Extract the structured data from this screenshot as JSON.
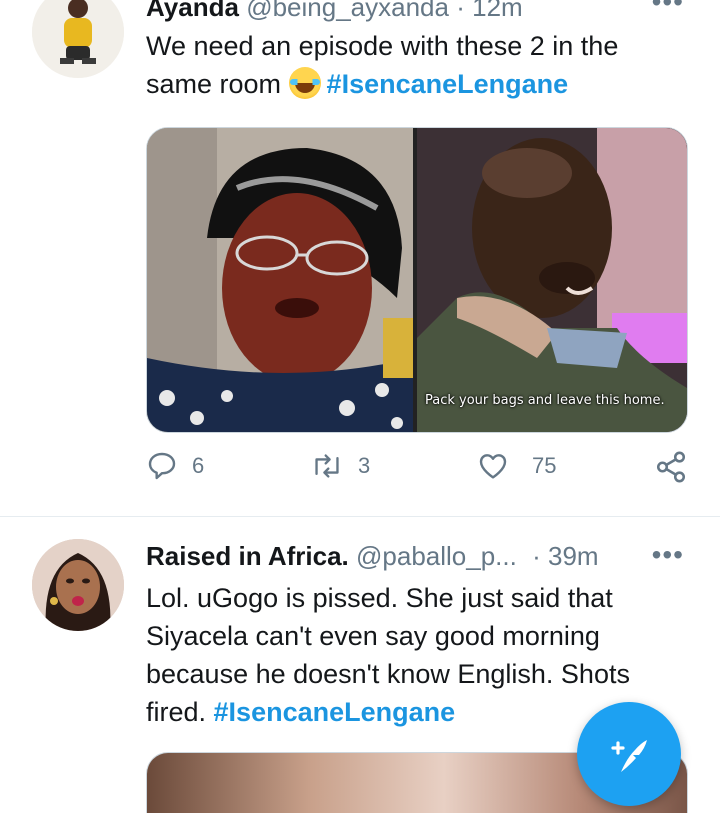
{
  "tweets": [
    {
      "display_name": "Ayanda",
      "handle": "@being_ayxanda",
      "separator": "·",
      "time": "12m",
      "text_parts": [
        "We need an episode with these 2 in the",
        "same room "
      ],
      "hashtag": "#IsencaneLengane",
      "media": {
        "subtitle_right": "Pack your bags and leave this home."
      },
      "stats": {
        "replies": "6",
        "retweets": "3",
        "likes": "75"
      }
    },
    {
      "display_name": "Raised in Africa.",
      "handle": "@paballo_p...",
      "separator": "·",
      "time": "39m",
      "text": "Lol. uGogo is pissed. She just said that Siyacela can't even say good morning because he doesn't know English. Shots fired. ",
      "hashtag": "#IsencaneLengane"
    }
  ],
  "icons": {
    "more": "more-horizontal-icon",
    "reply": "reply-icon",
    "retweet": "retweet-icon",
    "like": "heart-icon",
    "share": "share-icon",
    "compose": "compose-tweet-icon",
    "emoji": "face-with-tears-of-joy-emoji"
  },
  "colors": {
    "accent": "#1da1f2",
    "hashtag": "#1b95e0",
    "secondary_text": "#657786"
  }
}
